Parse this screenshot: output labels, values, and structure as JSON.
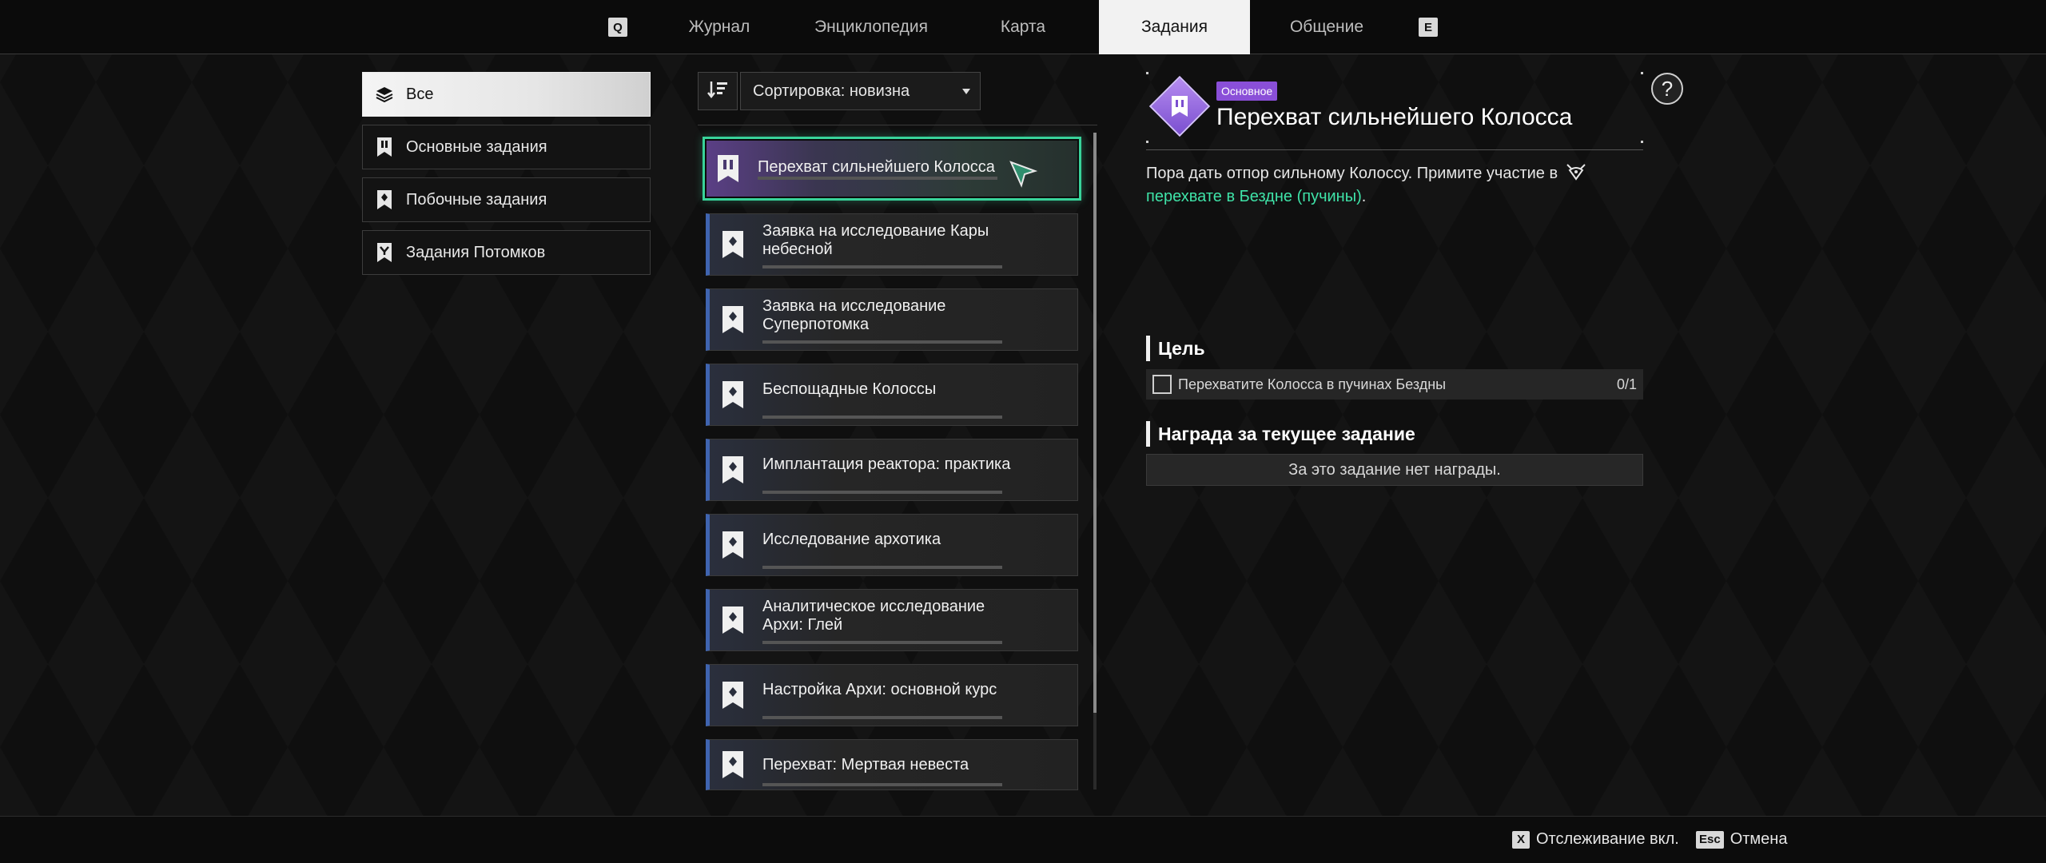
{
  "topnav": {
    "left_key": "Q",
    "right_key": "E",
    "tabs": [
      {
        "label": "Журнал"
      },
      {
        "label": "Энциклопедия"
      },
      {
        "label": "Карта"
      },
      {
        "label": "Задания",
        "active": true
      },
      {
        "label": "Общение"
      }
    ]
  },
  "categories": [
    {
      "label": "Все",
      "icon": "layers-icon",
      "active": true
    },
    {
      "label": "Основные задания",
      "icon": "main-quest-bookmark-icon"
    },
    {
      "label": "Побочные задания",
      "icon": "side-quest-bookmark-icon"
    },
    {
      "label": "Задания Потомков",
      "icon": "descendant-quest-bookmark-icon"
    }
  ],
  "sort": {
    "icon": "sort-descending-icon",
    "label": "Сортировка: новизна"
  },
  "quests": [
    {
      "title": "Перехват сильнейшего Колосса",
      "active": true
    },
    {
      "title": "Заявка на исследование Кары небесной"
    },
    {
      "title": "Заявка на исследование Суперпотомка"
    },
    {
      "title": "Беспощадные Колоссы"
    },
    {
      "title": "Имплантация реактора: практика"
    },
    {
      "title": "Исследование архотика"
    },
    {
      "title": "Аналитическое исследование Архи: Глей"
    },
    {
      "title": "Настройка Архи: основной курс"
    },
    {
      "title": "Перехват: Мертвая невеста"
    }
  ],
  "detail": {
    "badge": "Основное",
    "title": "Перехват сильнейшего Колосса",
    "description_text": "Пора дать отпор сильному Колоссу. Примите участие в",
    "description_highlight": "перехвате в Бездне (пучины)",
    "description_end": ".",
    "goal_header": "Цель",
    "goal_text": "Перехватите Колосса в пучинах Бездны",
    "goal_count": "0/1",
    "reward_header": "Награда за текущее задание",
    "reward_text": "За это задание нет награды."
  },
  "bottom": {
    "track_key": "X",
    "track_label": "Отслеживание вкл.",
    "cancel_key": "Esc",
    "cancel_label": "Отмена"
  },
  "colors": {
    "accent_green": "#38d39a",
    "highlight_text": "#3fe3a8",
    "main_badge": "#8a4fd8",
    "quest_stripe": "#3f64b0"
  }
}
